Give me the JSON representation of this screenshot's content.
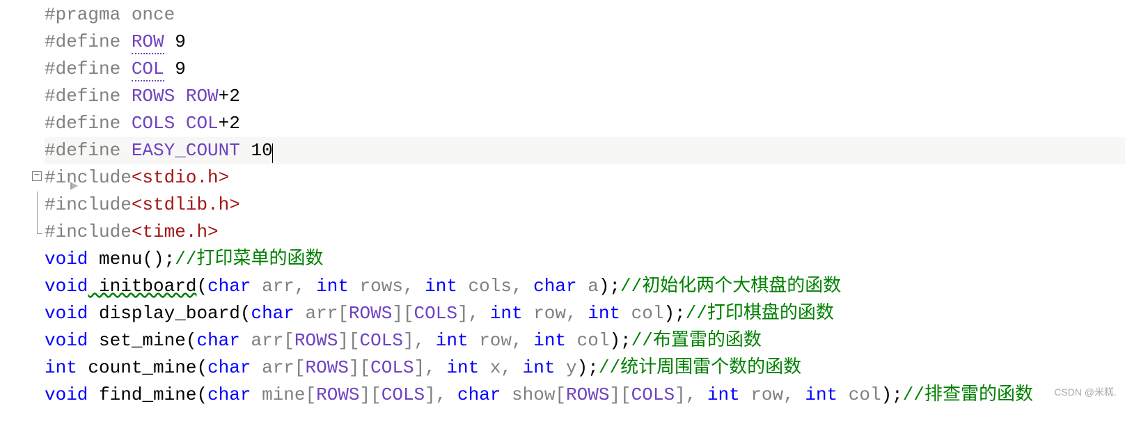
{
  "code": {
    "lines": [
      {
        "pre": "#pragma once",
        "rest": ""
      },
      {
        "pre": "#define ",
        "mac": "ROW",
        "val": " 9"
      },
      {
        "pre": "#define ",
        "mac": "COL",
        "val": " 9"
      },
      {
        "pre": "#define ",
        "mac": "ROWS",
        "val_mac": " ROW",
        "val": "+2"
      },
      {
        "pre": "#define ",
        "mac": "COLS",
        "val_mac": " COL",
        "val": "+2"
      },
      {
        "pre": "#define ",
        "mac": "EASY_COUNT",
        "val": " 10"
      },
      {
        "pre": "#include",
        "hdr": "<stdio.h>"
      },
      {
        "pre": "#include",
        "hdr": "<stdlib.h>"
      },
      {
        "pre": "#include",
        "hdr": "<time.h>"
      }
    ],
    "fn_menu": {
      "kw": "void",
      "name": " menu",
      "sig": "();",
      "cmt": "//打印菜单的函数"
    },
    "fn_init": {
      "kw": "void",
      "name": " initboard",
      "open": "(",
      "t1": "char",
      "p1": " arr, ",
      "t2": "int",
      "p2": " rows, ",
      "t3": "int",
      "p3": " cols, ",
      "t4": "char",
      "p4": " a",
      "close": ");",
      "cmt": "//初始化两个大棋盘的函数"
    },
    "fn_disp": {
      "kw": "void",
      "name": " display_board",
      "open": "(",
      "t1": "char",
      "p1": " arr[",
      "m1": "ROWS",
      "b1": "][",
      "m2": "COLS",
      "b2": "], ",
      "t2": "int",
      "p2": " row, ",
      "t3": "int",
      "p3": " col",
      "close": ");",
      "cmt": "//打印棋盘的函数"
    },
    "fn_set": {
      "kw": "void",
      "name": " set_mine",
      "open": "(",
      "t1": "char",
      "p1": " arr[",
      "m1": "ROWS",
      "b1": "][",
      "m2": "COLS",
      "b2": "], ",
      "t2": "int",
      "p2": " row, ",
      "t3": "int",
      "p3": " col",
      "close": ");",
      "cmt": "//布置雷的函数"
    },
    "fn_cnt": {
      "kw": "int",
      "name": " count_mine",
      "open": "(",
      "t1": "char",
      "p1": " arr[",
      "m1": "ROWS",
      "b1": "][",
      "m2": "COLS",
      "b2": "], ",
      "t2": "int",
      "p2": " x, ",
      "t3": "int",
      "p3": " y",
      "close": ");",
      "cmt": "//统计周围雷个数的函数"
    },
    "fn_find": {
      "kw": "void",
      "name": " find_mine",
      "open": "(",
      "t1": "char",
      "p1": " mine[",
      "m1": "ROWS",
      "b1": "][",
      "m2": "COLS",
      "b2": "], ",
      "t2": "char",
      "p2": " show[",
      "m3": "ROWS",
      "b3": "][",
      "m4": "COLS",
      "b4": "], ",
      "t3": "int",
      "p3": " row, ",
      "t4": "int",
      "p4": " col",
      "close": ");",
      "cmt": "//排查雷的函数"
    }
  },
  "watermark": "CSDN @米糕."
}
